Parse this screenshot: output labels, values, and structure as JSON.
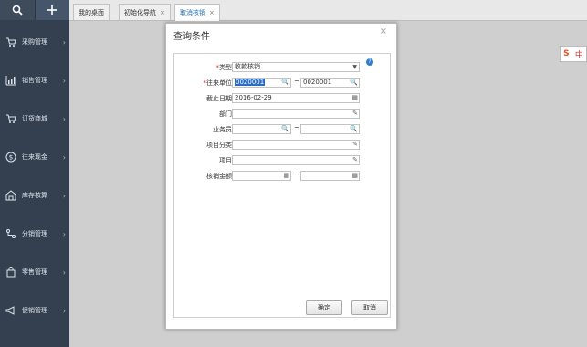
{
  "sidebar": {
    "items": [
      {
        "label": "采购管理",
        "icon": "cart-icon"
      },
      {
        "label": "销售管理",
        "icon": "chart-icon"
      },
      {
        "label": "订货商城",
        "icon": "shop-cart-icon"
      },
      {
        "label": "往来现金",
        "icon": "currency-icon"
      },
      {
        "label": "库存核算",
        "icon": "warehouse-icon"
      },
      {
        "label": "分销管理",
        "icon": "distribution-icon"
      },
      {
        "label": "零售管理",
        "icon": "bag-icon"
      },
      {
        "label": "促销管理",
        "icon": "megaphone-icon"
      }
    ]
  },
  "tabs": [
    {
      "label": "我的桌面"
    },
    {
      "label": "初始化导航"
    },
    {
      "label": "取消核销"
    }
  ],
  "ime": {
    "s": "S",
    "zh": "中"
  },
  "dialog": {
    "title": "查询条件",
    "close": "×",
    "help": "?",
    "fields": {
      "type": {
        "label": "类型",
        "value": "收款核销"
      },
      "unit": {
        "label": "往来单位",
        "from": "0020001",
        "to": "0020001"
      },
      "date": {
        "label": "截止日期",
        "value": "2016-02-29"
      },
      "dept": {
        "label": "部门",
        "value": ""
      },
      "staff": {
        "label": "业务员",
        "from": "",
        "to": ""
      },
      "proj_cat": {
        "label": "项目分类",
        "value": ""
      },
      "project": {
        "label": "项目",
        "value": ""
      },
      "amount": {
        "label": "核销金额",
        "from": "",
        "to": ""
      }
    },
    "range_sep": "~",
    "ok": "确定",
    "cancel": "取消"
  },
  "colors": {
    "sidebar": "#34404f",
    "accent": "#1f6fb5",
    "required": "#e22222",
    "selection": "#2b6cc4"
  }
}
